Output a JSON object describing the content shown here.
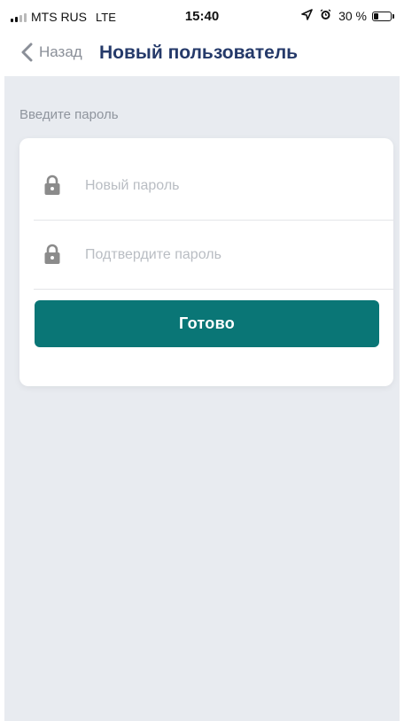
{
  "status_bar": {
    "carrier": "MTS RUS",
    "network": "LTE",
    "time": "15:40",
    "battery_text": "30 %",
    "battery_level": 0.3,
    "icons": [
      "signal-icon",
      "location-arrow-icon",
      "alarm-icon",
      "battery-icon"
    ]
  },
  "nav": {
    "back_label": "Назад",
    "title": "Новый пользователь"
  },
  "form": {
    "section_label": "Введите пароль",
    "new_password": {
      "value": "",
      "placeholder": "Новый пароль"
    },
    "confirm_password": {
      "value": "",
      "placeholder": "Подтвердите пароль"
    },
    "submit_label": "Готово"
  },
  "colors": {
    "accent": "#0a7676",
    "title": "#253a6a",
    "background": "#e8ebf0"
  }
}
